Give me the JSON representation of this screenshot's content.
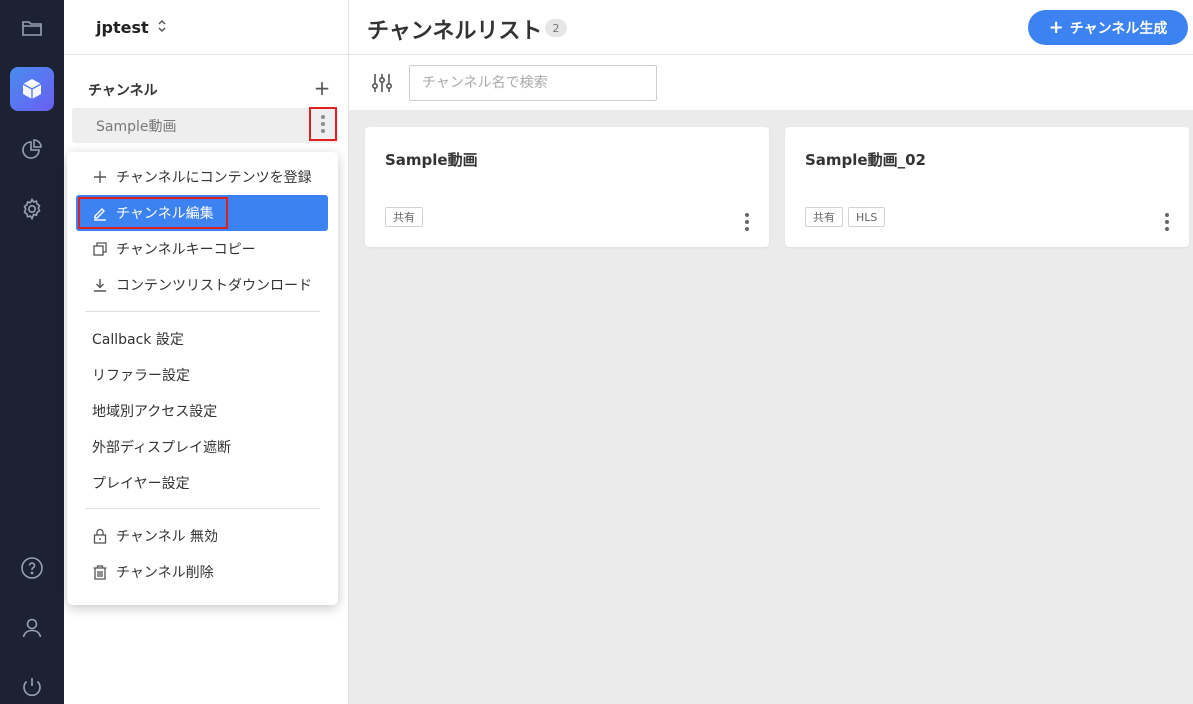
{
  "sidebar": {
    "project_name": "jptest",
    "project_chevron": "⌃⌄",
    "section_title": "チャンネル",
    "add_symbol": "+",
    "channels": [
      {
        "label": "Sample動画"
      }
    ]
  },
  "menu": {
    "items": [
      {
        "label": "チャンネルにコンテンツを登録",
        "icon": "plus-icon"
      },
      {
        "label": "チャンネル編集",
        "icon": "edit-icon",
        "highlighted": true
      },
      {
        "label": "チャンネルキーコピー",
        "icon": "copy-icon"
      },
      {
        "label": "コンテンツリストダウンロード",
        "icon": "download-icon"
      },
      {
        "label": "Callback 設定"
      },
      {
        "label": "リファラー設定"
      },
      {
        "label": "地域別アクセス設定"
      },
      {
        "label": "外部ディスプレイ遮断"
      },
      {
        "label": "プレイヤー設定"
      },
      {
        "label": "チャンネル 無効",
        "icon": "lock-icon"
      },
      {
        "label": "チャンネル削除",
        "icon": "trash-icon"
      }
    ]
  },
  "main": {
    "title": "チャンネルリスト",
    "count": "2",
    "create_button": "チャンネル生成",
    "create_plus": "+",
    "search_placeholder": "チャンネル名で検索",
    "cards": [
      {
        "title": "Sample動画",
        "tags": [
          "共有"
        ]
      },
      {
        "title": "Sample動画_02",
        "tags": [
          "共有",
          "HLS"
        ]
      }
    ]
  },
  "colors": {
    "rail_bg": "#1d2233",
    "accent": "#3c82f0",
    "annotation_red": "#e02020",
    "main_bg": "#ebebeb"
  },
  "rail_icons": [
    "folder-icon",
    "cube-icon",
    "pie-chart-icon",
    "gear-icon",
    "help-icon",
    "user-icon",
    "power-icon"
  ]
}
